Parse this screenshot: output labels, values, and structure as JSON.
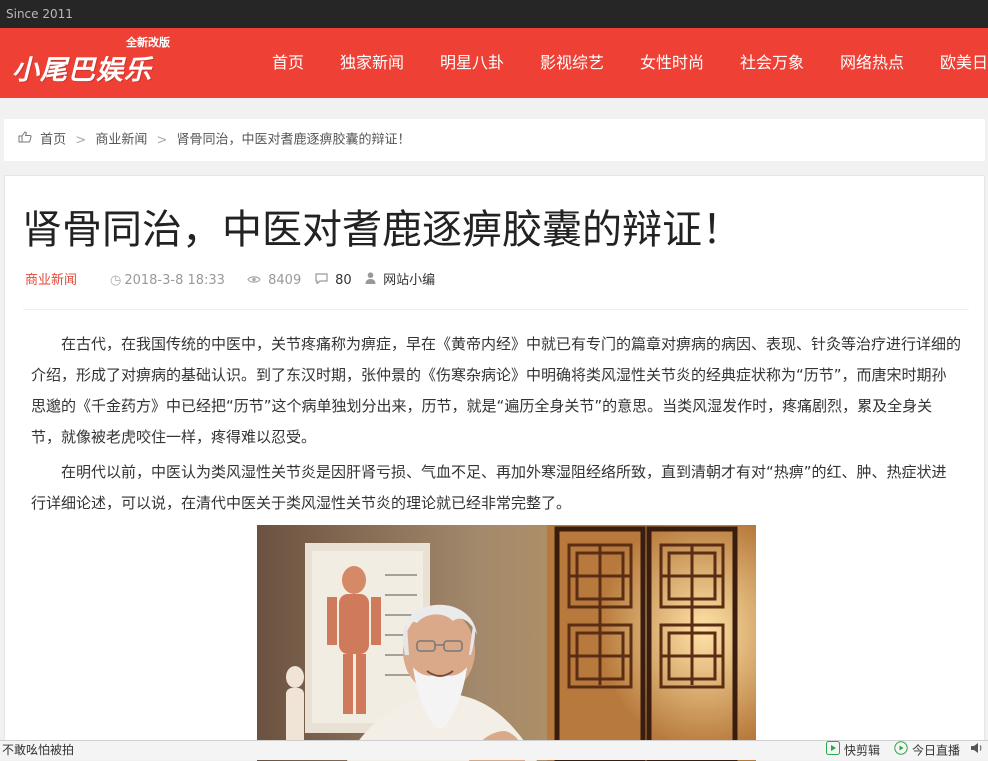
{
  "topbar": {
    "since": "Since 2011"
  },
  "header": {
    "logo_text": "小尾巴娱乐",
    "logo_badge": "全新改版",
    "nav": [
      "首页",
      "独家新闻",
      "明星八卦",
      "影视综艺",
      "女性时尚",
      "社会万象",
      "网络热点",
      "欧美日"
    ]
  },
  "breadcrumb": {
    "home_icon": "hand-point-icon",
    "items": [
      "首页",
      "商业新闻",
      "肾骨同治，中医对耆鹿逐痹胶囊的辩证！"
    ],
    "separator": ">"
  },
  "article": {
    "title": "肾骨同治，中医对耆鹿逐痹胶囊的辩证！",
    "meta": {
      "category": "商业新闻",
      "datetime": "2018-3-8 18:33",
      "views": "8409",
      "comments": "80",
      "author": "网站小编"
    },
    "paragraphs": [
      "在古代，在我国传统的中医中，关节疼痛称为痹症，早在《黄帝内经》中就已有专门的篇章对痹病的病因、表现、针灸等治疗进行详细的介绍，形成了对痹病的基础认识。到了东汉时期，张仲景的《伤寒杂病论》中明确将类风湿性关节炎的经典症状称为“历节”，而唐宋时期孙思邈的《千金药方》中已经把“历节”这个病单独划分出来，历节，就是“遍历全身关节”的意思。当类风湿发作时，疼痛剧烈，累及全身关节，就像被老虎咬住一样，疼得难以忍受。",
      "在明代以前，中医认为类风湿性关节炎是因肝肾亏损、气血不足、再加外寒湿阻经络所致，直到清朝才有对“热痹”的红、肿、热症状进行详细论述，可以说，在清代中医关于类风湿性关节炎的理论就已经非常完整了。"
    ]
  },
  "bottombar": {
    "left_text": "不敢吆怕被拍",
    "items": [
      "快剪辑",
      "今日直播"
    ]
  },
  "colors": {
    "brand_red": "#ee4035",
    "category_red": "#e4493a",
    "topbar_bg": "#262626"
  }
}
